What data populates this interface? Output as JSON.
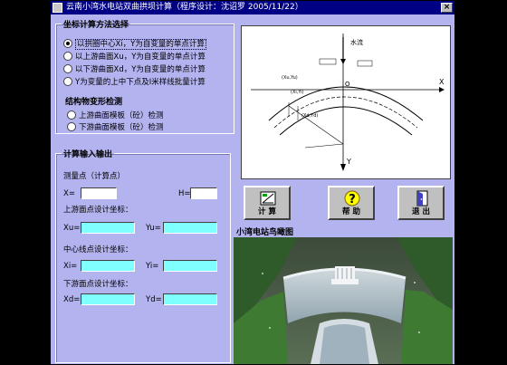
{
  "window": {
    "title": "云南小湾水电站双曲拱坝计算（程序设计：沈诏罗  2005/11/22）",
    "close_label": "×"
  },
  "method_group": {
    "legend": "坐标计算方法选择",
    "options": [
      {
        "label": "以拱圈中心Xi，Y为自变量的单点计算",
        "selected": true
      },
      {
        "label": "以上游曲面Xu，Y为自变量的单点计算",
        "selected": false
      },
      {
        "label": "以下游曲面Xd，Y为自变量的单点计算",
        "selected": false
      },
      {
        "label": "Y为变量的上中下点及I米样线批量计算",
        "selected": false
      }
    ],
    "subheading": "结构物变形检测",
    "check_options": [
      {
        "label": "上游曲面模板（砼）检测",
        "selected": false
      },
      {
        "label": "下游曲面模板（砼）检测",
        "selected": false
      }
    ]
  },
  "io_group": {
    "legend": "计算输入输出",
    "measure_label": "测量点（计算点）",
    "x_label": "X=",
    "x_value": "",
    "h_label": "H=",
    "h_value": "",
    "upstream_label": "上游面点设计坐标：",
    "xu_label": "Xu=",
    "yu_label": "Yu=",
    "center_label": "中心线点设计坐标：",
    "xi_label": "Xi=",
    "yi_label": "Yi=",
    "downstream_label": "下游面点设计坐标：",
    "xd_label": "Xd=",
    "yd_label": "Yd="
  },
  "diagram": {
    "flow_label": "水流",
    "x_axis": "X",
    "y_axis": "Y",
    "origin": "O",
    "tags": [
      "(Xu,Yu)",
      "(Xi,Yi)",
      "(Xd,Yd)"
    ]
  },
  "buttons": {
    "calc": "计  算",
    "help": "帮  助",
    "exit": "退  出"
  },
  "photo_caption": "小湾电站鸟瞰图",
  "colors": {
    "window_bg": "#b3b3ef",
    "titlebar": "#000084",
    "output_field": "#80ffff"
  }
}
